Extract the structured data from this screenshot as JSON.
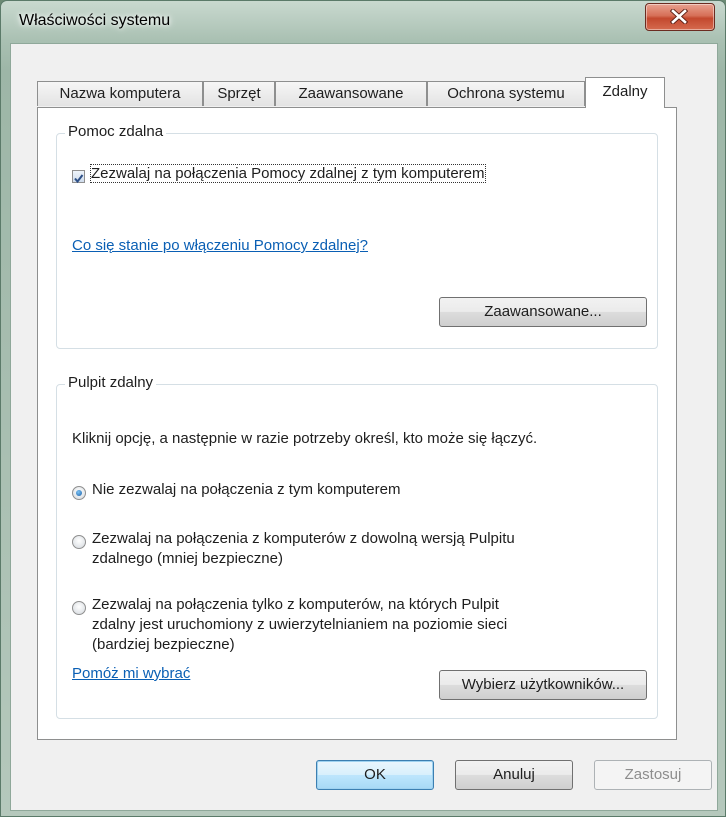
{
  "window": {
    "title": "Właściwości systemu",
    "close_icon": "close-icon"
  },
  "tabs": [
    {
      "label": "Nazwa komputera",
      "active": false
    },
    {
      "label": "Sprzęt",
      "active": false
    },
    {
      "label": "Zaawansowane",
      "active": false
    },
    {
      "label": "Ochrona systemu",
      "active": false
    },
    {
      "label": "Zdalny",
      "active": true
    }
  ],
  "remote_assistance": {
    "group_title": "Pomoc zdalna",
    "allow_checkbox": {
      "label": "Zezwalaj na połączenia Pomocy zdalnej z tym komputerem",
      "checked": true
    },
    "help_link": "Co się stanie po włączeniu Pomocy zdalnej?",
    "advanced_button": "Zaawansowane..."
  },
  "remote_desktop": {
    "group_title": "Pulpit zdalny",
    "instruction": "Kliknij opcję, a następnie w razie potrzeby określ, kto może się łączyć.",
    "options": [
      {
        "line1": "Nie zezwalaj na połączenia z tym komputerem",
        "line2": "",
        "line3": "",
        "checked": true
      },
      {
        "line1": "Zezwalaj na połączenia z komputerów z dowolną wersją Pulpitu",
        "line2": "zdalnego (mniej bezpieczne)",
        "line3": "",
        "checked": false
      },
      {
        "line1": "Zezwalaj na połączenia tylko z komputerów, na których Pulpit",
        "line2": "zdalny jest uruchomiony z uwierzytelnianiem na poziomie sieci",
        "line3": "(bardziej bezpieczne)",
        "checked": false
      }
    ],
    "help_link": "Pomóż mi wybrać",
    "select_users_button": "Wybierz użytkowników..."
  },
  "footer": {
    "ok": "OK",
    "cancel": "Anuluj",
    "apply": "Zastosuj",
    "apply_enabled": false
  }
}
